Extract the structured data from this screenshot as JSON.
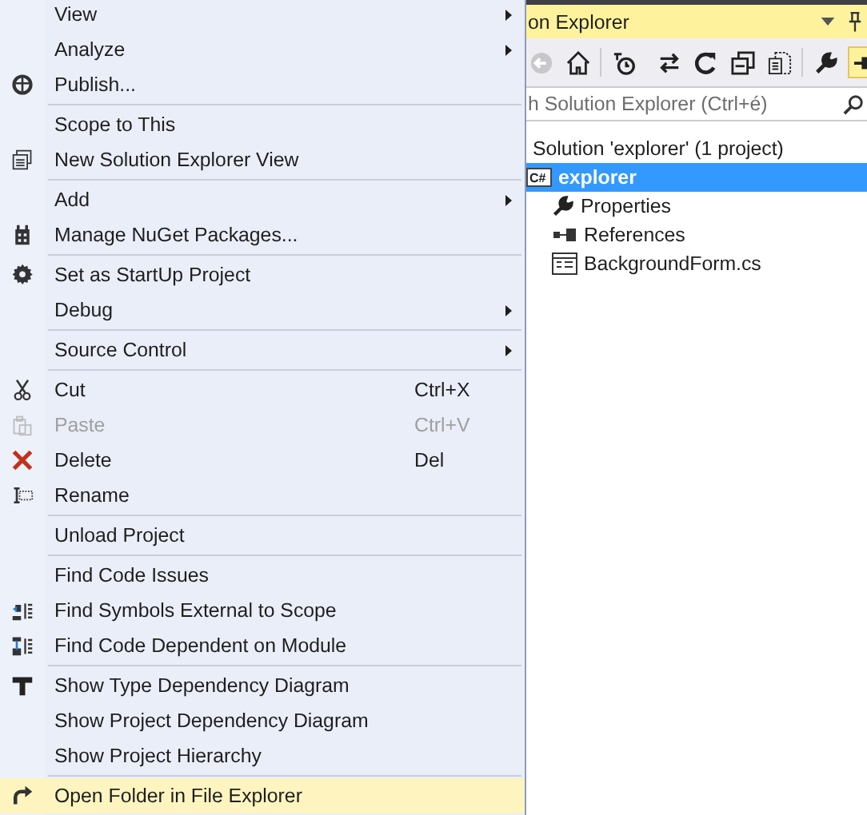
{
  "context_menu": {
    "items": [
      {
        "kind": "item",
        "label": "View",
        "submenu": true,
        "disabled": false,
        "selected": false
      },
      {
        "kind": "item",
        "label": "Analyze",
        "submenu": true,
        "disabled": false,
        "selected": false
      },
      {
        "kind": "item",
        "label": "Publish...",
        "submenu": false,
        "disabled": false,
        "selected": false
      },
      {
        "kind": "separator"
      },
      {
        "kind": "item",
        "label": "Scope to This",
        "submenu": false,
        "disabled": false,
        "selected": false
      },
      {
        "kind": "item",
        "label": "New Solution Explorer View",
        "submenu": false,
        "disabled": false,
        "selected": false
      },
      {
        "kind": "separator"
      },
      {
        "kind": "item",
        "label": "Add",
        "submenu": true,
        "disabled": false,
        "selected": false
      },
      {
        "kind": "item",
        "label": "Manage NuGet Packages...",
        "submenu": false,
        "disabled": false,
        "selected": false
      },
      {
        "kind": "separator"
      },
      {
        "kind": "item",
        "label": "Set as StartUp Project",
        "submenu": false,
        "disabled": false,
        "selected": false
      },
      {
        "kind": "item",
        "label": "Debug",
        "submenu": true,
        "disabled": false,
        "selected": false
      },
      {
        "kind": "separator"
      },
      {
        "kind": "item",
        "label": "Source Control",
        "submenu": true,
        "disabled": false,
        "selected": false
      },
      {
        "kind": "separator"
      },
      {
        "kind": "item",
        "label": "Cut",
        "shortcut": "Ctrl+X",
        "submenu": false,
        "disabled": false,
        "selected": false
      },
      {
        "kind": "item",
        "label": "Paste",
        "shortcut": "Ctrl+V",
        "submenu": false,
        "disabled": true,
        "selected": false
      },
      {
        "kind": "item",
        "label": "Delete",
        "shortcut": "Del",
        "submenu": false,
        "disabled": false,
        "selected": false
      },
      {
        "kind": "item",
        "label": "Rename",
        "submenu": false,
        "disabled": false,
        "selected": false
      },
      {
        "kind": "separator"
      },
      {
        "kind": "item",
        "label": "Unload Project",
        "submenu": false,
        "disabled": false,
        "selected": false
      },
      {
        "kind": "separator"
      },
      {
        "kind": "item",
        "label": "Find Code Issues",
        "submenu": false,
        "disabled": false,
        "selected": false
      },
      {
        "kind": "item",
        "label": "Find Symbols External to Scope",
        "submenu": false,
        "disabled": false,
        "selected": false
      },
      {
        "kind": "item",
        "label": "Find Code Dependent on Module",
        "submenu": false,
        "disabled": false,
        "selected": false
      },
      {
        "kind": "separator"
      },
      {
        "kind": "item",
        "label": "Show Type Dependency Diagram",
        "submenu": false,
        "disabled": false,
        "selected": false
      },
      {
        "kind": "item",
        "label": "Show Project Dependency Diagram",
        "submenu": false,
        "disabled": false,
        "selected": false
      },
      {
        "kind": "item",
        "label": "Show Project Hierarchy",
        "submenu": false,
        "disabled": false,
        "selected": false
      },
      {
        "kind": "separator"
      },
      {
        "kind": "item",
        "label": "Open Folder in File Explorer",
        "submenu": false,
        "disabled": false,
        "selected": true
      }
    ]
  },
  "solution_explorer": {
    "title": "on Explorer",
    "search": {
      "placeholder": "h Solution Explorer (Ctrl+é)"
    },
    "tree": [
      {
        "label": "Solution 'explorer' (1 project)",
        "selected": false,
        "children": [
          {
            "label": "explorer",
            "icon_text": "C#",
            "selected": true,
            "children": [
              {
                "label": "Properties",
                "selected": false
              },
              {
                "label": "References",
                "selected": false
              },
              {
                "label": "BackgroundForm.cs",
                "selected": false
              }
            ]
          }
        ]
      }
    ]
  }
}
